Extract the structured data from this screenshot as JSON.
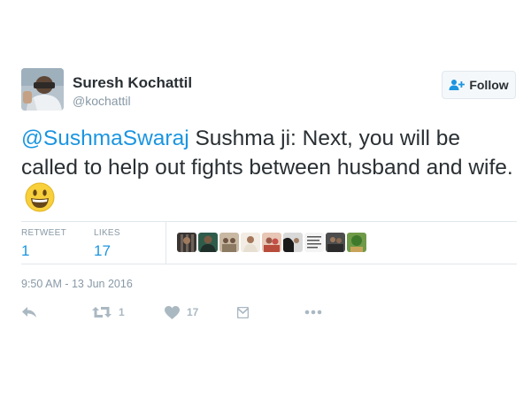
{
  "author": {
    "display_name": "Suresh Kochattil",
    "screen_name": "@kochattil",
    "avatar_icon": "profile-photo"
  },
  "follow_button": {
    "label": "Follow",
    "icon": "follow-person-plus-icon"
  },
  "tweet": {
    "mention": "@SushmaSwaraj",
    "text": " Sushma ji: Next, you will be called to help out fights between husband and wife.",
    "emoji": "smiling-face-emoji"
  },
  "stats": {
    "retweets_label": "RETWEET",
    "retweets_value": "1",
    "likes_label": "LIKES",
    "likes_value": "17"
  },
  "timestamp": "9:50 AM - 13 Jun 2016",
  "actions": {
    "reply_icon": "reply-icon",
    "retweet_icon": "retweet-icon",
    "retweet_count": "1",
    "like_icon": "heart-icon",
    "like_count": "17",
    "dm_icon": "direct-message-icon",
    "more_icon": "more-dots-icon"
  },
  "colors": {
    "link": "#1b95e0",
    "text": "#292f33",
    "muted": "#8899a6",
    "action_gray": "#aab8c2",
    "border": "#e1e8ed"
  }
}
